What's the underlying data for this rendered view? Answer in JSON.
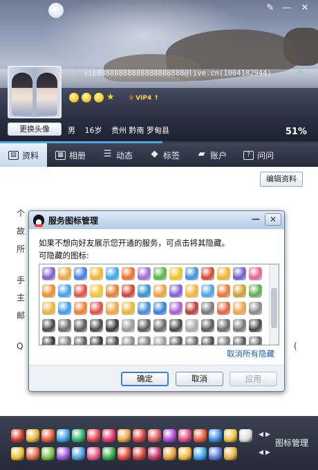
{
  "header": {
    "email": "vip88888888888888888888@live.cn(1004182944)",
    "change_avatar": "更换头像",
    "gender": "男",
    "age": "16岁",
    "location": "贵州 黔南 罗甸县",
    "completeness": "51%",
    "completeness_value": 0.51,
    "vip_label": "VIP4 ↑",
    "controls": {
      "skin": "✎",
      "minimize": "—",
      "close": "✕"
    }
  },
  "tabs": [
    {
      "label": "资料",
      "icon": "profile-card-icon"
    },
    {
      "label": "相册",
      "icon": "photo-album-icon"
    },
    {
      "label": "动态",
      "icon": "feed-list-icon"
    },
    {
      "label": "标签",
      "icon": "tag-icon"
    },
    {
      "label": "账户",
      "icon": "wallet-icon"
    },
    {
      "label": "问问",
      "icon": "question-icon"
    }
  ],
  "body": {
    "edit_button": "编辑资料",
    "partial_labels": [
      "个",
      "故",
      "所",
      "手",
      "主",
      "邮"
    ],
    "q_left": "Q",
    "q_right": "("
  },
  "dialog": {
    "title": "服务图标管理",
    "description": "如果不想向好友展示您开通的服务，可点击将其隐藏。",
    "hidden_label": "可隐藏的图标:",
    "unhide_link": "取消所有隐藏",
    "ok": "确定",
    "cancel": "取消",
    "apply": "应用",
    "icon_colors": [
      "#7a5cc7",
      "#e8a83a",
      "#3f7be0",
      "#f2b52a",
      "#39a7e6",
      "#f06b2a",
      "#9c6bd6",
      "#54b548",
      "#f0c419",
      "#3e8de0",
      "#d9432e",
      "#f4b223",
      "#6a5acd",
      "#e85d9a",
      "#f08a24",
      "#3da0e8",
      "#e44c3c",
      "#f5c32c",
      "#e87a2b",
      "#cf3f2b",
      "#2f8fd6",
      "#e9a23b",
      "#7d5bd0",
      "#f3b43a",
      "#4aa3e0",
      "#e8762c",
      "#c9a227",
      "#5cab4a",
      "#e9b23a",
      "#3a9be6",
      "#f07b2a",
      "#e24b3b",
      "#f1a43c",
      "#e8b731",
      "#3e8ad6",
      "#2d7fd4",
      "#a95ad0",
      "#b8383a",
      "#777777",
      "#e45f3a",
      "#f0a040",
      "#888888",
      "#444444",
      "#666666",
      "#555555",
      "#444444",
      "#333333",
      "#999999",
      "#555555",
      "#666666",
      "#444444",
      "#aaaaaa",
      "#555555",
      "#666666",
      "#777777",
      "#444444",
      "#333333",
      "#777777",
      "#555555",
      "#333333",
      "#444444",
      "#888888",
      "#777777",
      "#999999",
      "#555555",
      "#666666",
      "#444444",
      "#777777",
      "#555555",
      "#666666"
    ]
  },
  "bottombar": {
    "icon_manager": "图标管理",
    "row1": [
      "#d33a2c",
      "#e8b73a",
      "#e85a3a",
      "#3fa0e6",
      "#34b56a",
      "#e84a4a",
      "#e73a6a",
      "#f0a23c",
      "#d9433a",
      "#e05a5a",
      "#b04ad0",
      "#e44c7a",
      "#ee5a3a",
      "#3a8ee0",
      "#f0c23a",
      "#dcdcdc"
    ],
    "row2": [
      "#f1c02c",
      "#e66a4a",
      "#7ac043",
      "#9a5ad6",
      "#4a9ee0",
      "#e85a8a",
      "#3aaa4a",
      "#e44c3c",
      "#d3433a",
      "#c43a6a",
      "#e8a03a",
      "#f2b83a",
      "#3aa4e6",
      "#5a7ad6",
      "#e8b03a"
    ]
  }
}
